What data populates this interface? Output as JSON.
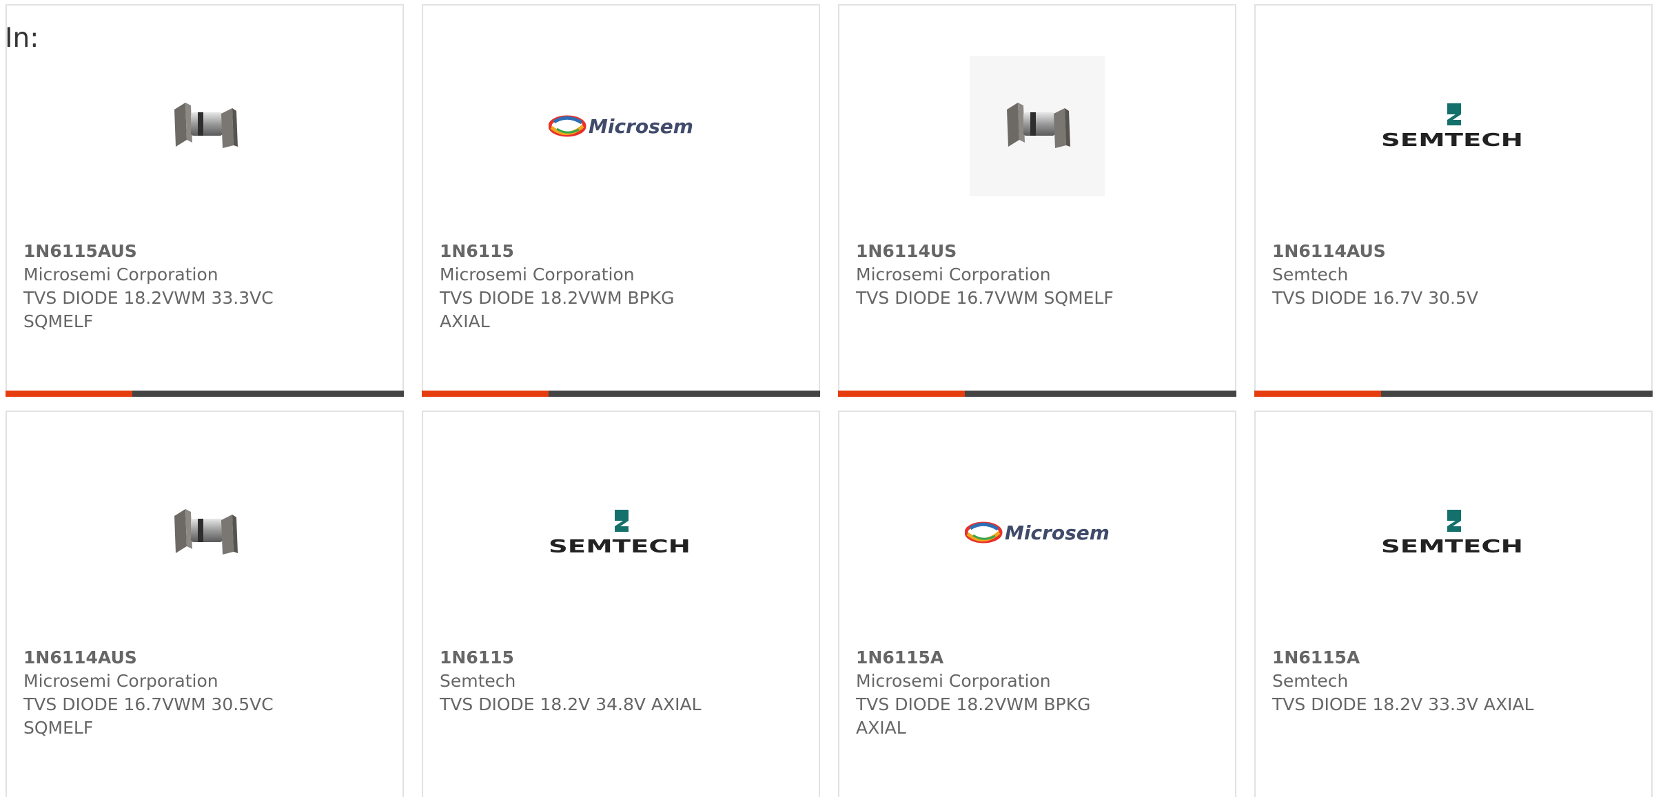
{
  "prefix_label": "In:",
  "colors": {
    "accent": "#e53d0e",
    "bar": "#444444",
    "border": "#e2e2e2",
    "text": "#666666"
  },
  "products": [
    {
      "part_number": "1N6115AUS",
      "manufacturer": "Microsemi Corporation",
      "description": "TVS DIODE 18.2VWM 33.3VC SQMELF",
      "image_icon": "diode-image-icon",
      "show_accent_bar": true
    },
    {
      "part_number": "1N6115",
      "manufacturer": "Microsemi Corporation",
      "description": "TVS DIODE 18.2VWM BPKG AXIAL",
      "image_icon": "microsemi-logo",
      "show_accent_bar": true
    },
    {
      "part_number": "1N6114US",
      "manufacturer": "Microsemi Corporation",
      "description": "TVS DIODE 16.7VWM SQMELF",
      "image_icon": "diode-image-icon",
      "show_accent_bar": true
    },
    {
      "part_number": "1N6114AUS",
      "manufacturer": "Semtech",
      "description": "TVS DIODE 16.7V 30.5V",
      "image_icon": "semtech-logo",
      "show_accent_bar": true
    },
    {
      "part_number": "1N6114AUS",
      "manufacturer": "Microsemi Corporation",
      "description": "TVS DIODE 16.7VWM 30.5VC SQMELF",
      "image_icon": "diode-image-icon",
      "show_accent_bar": false
    },
    {
      "part_number": "1N6115",
      "manufacturer": "Semtech",
      "description": "TVS DIODE 18.2V 34.8V AXIAL",
      "image_icon": "semtech-logo",
      "show_accent_bar": false
    },
    {
      "part_number": "1N6115A",
      "manufacturer": "Microsemi Corporation",
      "description": "TVS DIODE 18.2VWM BPKG AXIAL",
      "image_icon": "microsemi-logo",
      "show_accent_bar": false
    },
    {
      "part_number": "1N6115A",
      "manufacturer": "Semtech",
      "description": "TVS DIODE 18.2V 33.3V AXIAL",
      "image_icon": "semtech-logo",
      "show_accent_bar": false
    }
  ],
  "logos": {
    "microsemi": "Microsemi",
    "semtech": "SEMTECH"
  }
}
